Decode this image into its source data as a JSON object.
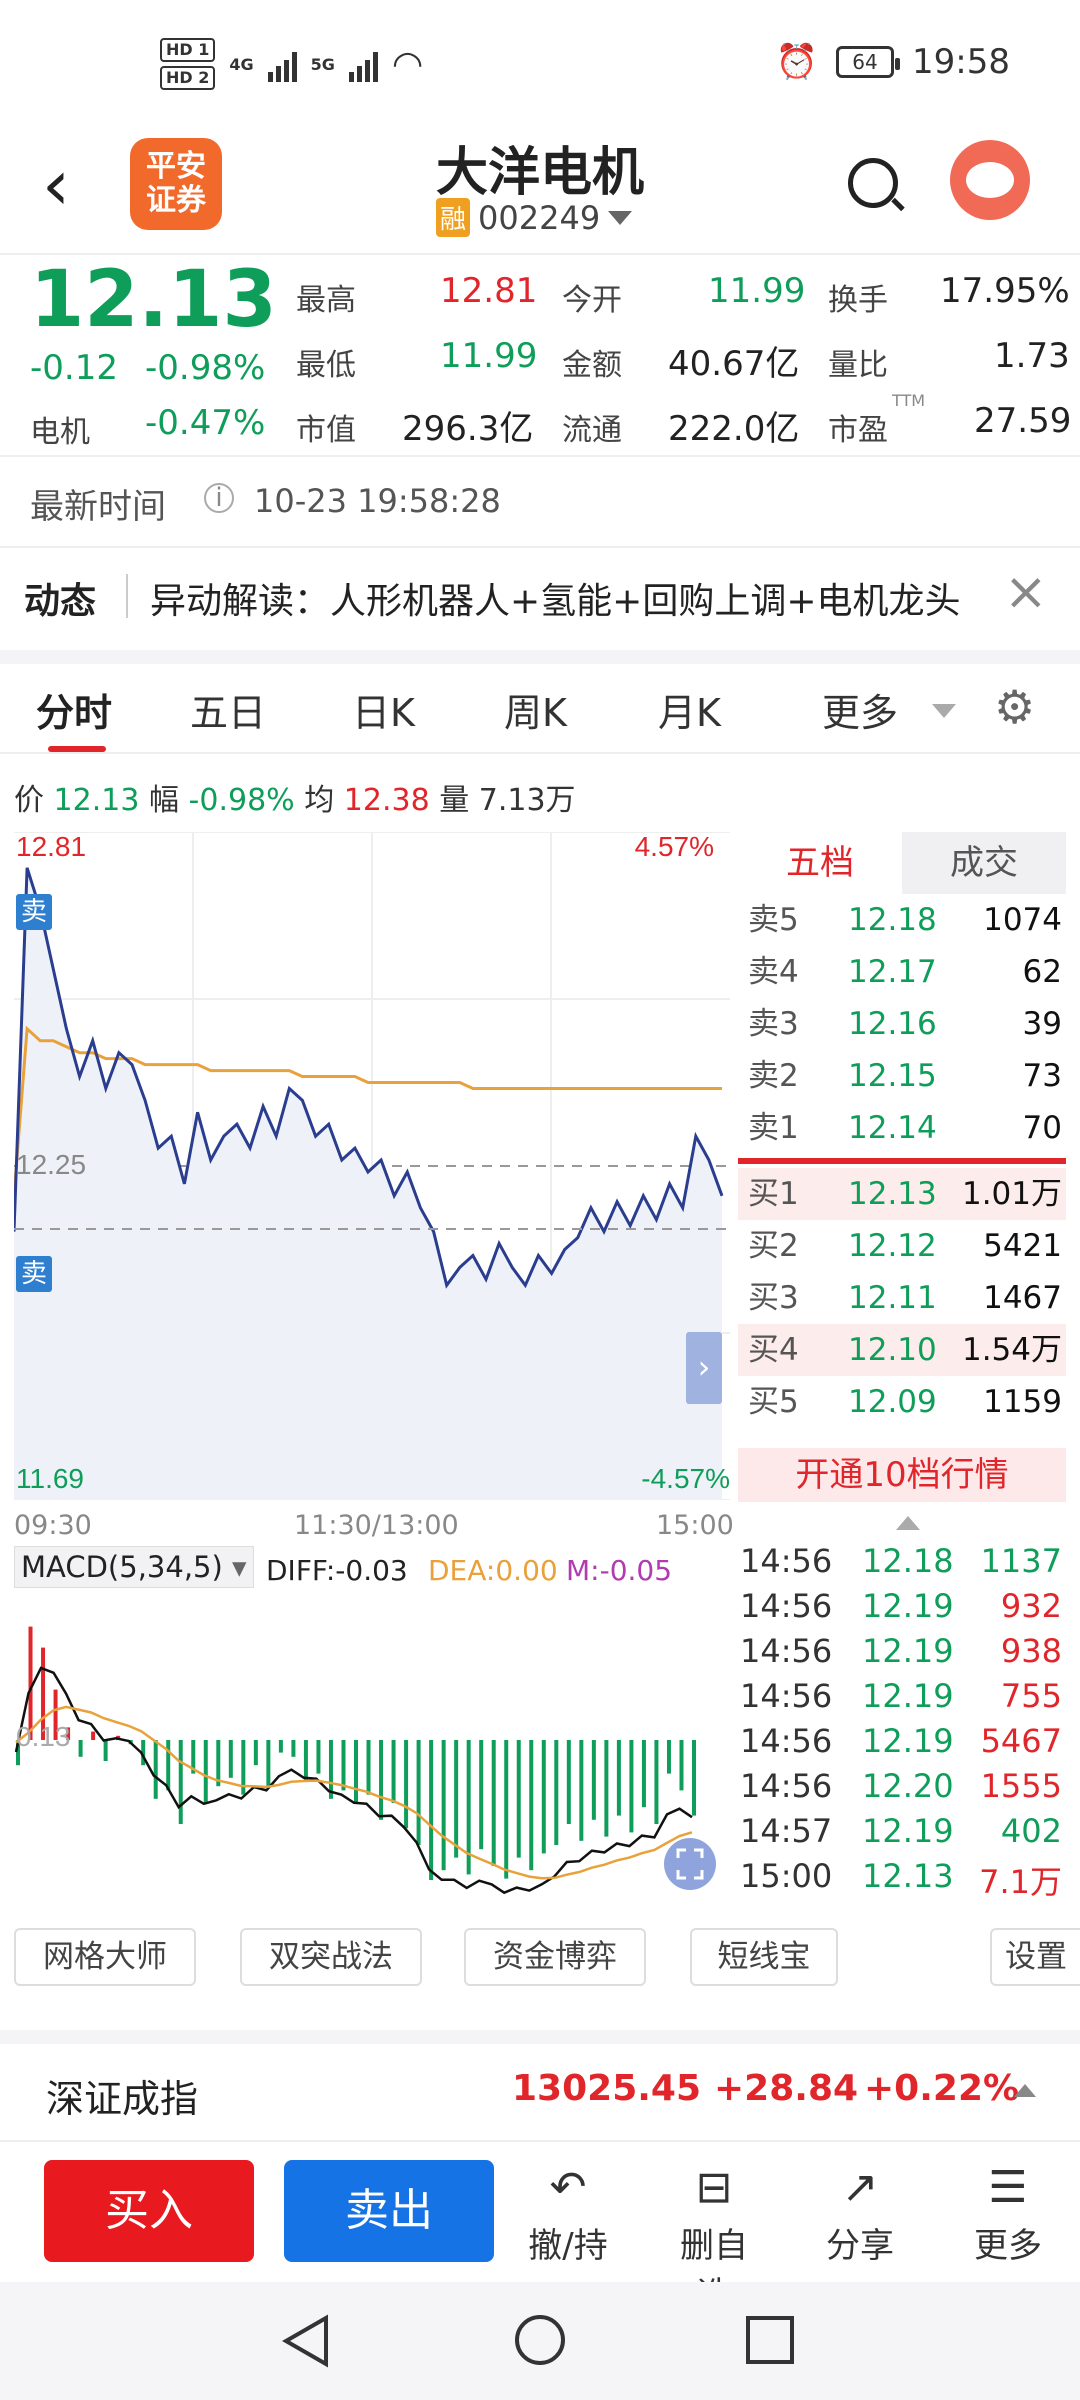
{
  "status_bar": {
    "hd1": "HD 1",
    "hd2": "HD 2",
    "net1": "4G",
    "net2": "5G",
    "battery": "64",
    "time": "19:58"
  },
  "header": {
    "logo_text": "平安证券",
    "stock_name": "大洋电机",
    "rong_badge": "融",
    "stock_code": "002249"
  },
  "quote": {
    "price": "12.13",
    "change": "-0.12",
    "change_pct": "-0.98%",
    "sector_label": "电机",
    "sector_pct": "-0.47%",
    "high_label": "最高",
    "high": "12.81",
    "open_label": "今开",
    "open": "11.99",
    "turnover_label": "换手",
    "turnover": "17.95%",
    "low_label": "最低",
    "low": "11.99",
    "amount_label": "金额",
    "amount": "40.67亿",
    "vol_ratio_label": "量比",
    "vol_ratio": "1.73",
    "mktcap_label": "市值",
    "mktcap": "296.3亿",
    "float_label": "流通",
    "float_cap": "222.0亿",
    "pe_label": "市盈",
    "pe_sup": "TTM",
    "pe": "27.59"
  },
  "update": {
    "label": "最新时间",
    "time": "10-23 19:58:28"
  },
  "news": {
    "tag": "动态",
    "text": "异动解读：人形机器人+氢能+回购上调+电机龙头"
  },
  "tabs": [
    "分时",
    "五日",
    "日K",
    "周K",
    "月K",
    "更多"
  ],
  "chart_info": {
    "price_label": "价",
    "price": "12.13",
    "amp_label": "幅",
    "amp": "-0.98%",
    "avg_label": "均",
    "avg": "12.38",
    "vol_label": "量",
    "vol": "7.13万"
  },
  "chart_data": {
    "type": "line",
    "title": "",
    "y_top": "12.81",
    "y_top_pct": "4.57%",
    "y_mid": "12.25",
    "y_bottom": "11.69",
    "y_bottom_pct": "-4.57%",
    "x_labels": [
      "09:30",
      "11:30/13:00",
      "15:00"
    ],
    "ylim": [
      11.69,
      12.81
    ],
    "price_series": [
      12.14,
      12.75,
      12.68,
      12.58,
      12.48,
      12.4,
      12.46,
      12.38,
      12.44,
      12.42,
      12.36,
      12.28,
      12.3,
      12.22,
      12.34,
      12.26,
      12.3,
      12.32,
      12.28,
      12.35,
      12.3,
      12.38,
      12.36,
      12.3,
      12.32,
      12.26,
      12.28,
      12.24,
      12.26,
      12.2,
      12.24,
      12.18,
      12.14,
      12.05,
      12.08,
      12.1,
      12.06,
      12.12,
      12.08,
      12.05,
      12.1,
      12.07,
      12.11,
      12.13,
      12.18,
      12.14,
      12.19,
      12.15,
      12.2,
      12.16,
      12.22,
      12.18,
      12.3,
      12.26,
      12.2
    ],
    "avg_series": [
      12.2,
      12.48,
      12.46,
      12.46,
      12.45,
      12.44,
      12.44,
      12.43,
      12.43,
      12.43,
      12.42,
      12.42,
      12.42,
      12.42,
      12.42,
      12.41,
      12.41,
      12.41,
      12.41,
      12.41,
      12.41,
      12.41,
      12.4,
      12.4,
      12.4,
      12.4,
      12.4,
      12.39,
      12.39,
      12.39,
      12.39,
      12.39,
      12.39,
      12.39,
      12.39,
      12.38,
      12.38,
      12.38,
      12.38,
      12.38,
      12.38,
      12.38,
      12.38,
      12.38,
      12.38,
      12.38,
      12.38,
      12.38,
      12.38,
      12.38,
      12.38,
      12.38,
      12.38,
      12.38,
      12.38
    ],
    "sell_markers": [
      "卖",
      "卖"
    ]
  },
  "orderbook": {
    "tab1": "五档",
    "tab2": "成交",
    "asks": [
      {
        "l": "卖5",
        "p": "12.18",
        "v": "1074"
      },
      {
        "l": "卖4",
        "p": "12.17",
        "v": "62"
      },
      {
        "l": "卖3",
        "p": "12.16",
        "v": "39"
      },
      {
        "l": "卖2",
        "p": "12.15",
        "v": "73"
      },
      {
        "l": "卖1",
        "p": "12.14",
        "v": "70"
      }
    ],
    "bids": [
      {
        "l": "买1",
        "p": "12.13",
        "v": "1.01万"
      },
      {
        "l": "买2",
        "p": "12.12",
        "v": "5421"
      },
      {
        "l": "买3",
        "p": "12.11",
        "v": "1467"
      },
      {
        "l": "买4",
        "p": "12.10",
        "v": "1.54万"
      },
      {
        "l": "买5",
        "p": "12.09",
        "v": "1159"
      }
    ],
    "open10": "开通10档行情"
  },
  "macd": {
    "label": "MACD(5,34,5)",
    "diff": "DIFF:-0.03",
    "dea": "DEA:0.00",
    "m": "M:-0.05",
    "ghost": "0.13"
  },
  "ticks": [
    {
      "t": "14:56",
      "p": "12.18",
      "v": "1137",
      "c": "green"
    },
    {
      "t": "14:56",
      "p": "12.19",
      "v": "932",
      "c": "red"
    },
    {
      "t": "14:56",
      "p": "12.19",
      "v": "938",
      "c": "red"
    },
    {
      "t": "14:56",
      "p": "12.19",
      "v": "755",
      "c": "red"
    },
    {
      "t": "14:56",
      "p": "12.19",
      "v": "5467",
      "c": "red"
    },
    {
      "t": "14:56",
      "p": "12.20",
      "v": "1555",
      "c": "red"
    },
    {
      "t": "14:57",
      "p": "12.19",
      "v": "402",
      "c": "green"
    },
    {
      "t": "15:00",
      "p": "12.13",
      "v": "7.1万",
      "c": "red"
    }
  ],
  "tools": [
    "网格大师",
    "双突战法",
    "资金博弈",
    "短线宝",
    "设置"
  ],
  "index": {
    "name": "深证成指",
    "value": "13025.45",
    "change": "+28.84",
    "pct": "+0.22%"
  },
  "bottom": {
    "buy": "买入",
    "sell": "卖出",
    "act1": "撤/持",
    "act2": "删自选",
    "act3": "分享",
    "act4": "更多"
  }
}
